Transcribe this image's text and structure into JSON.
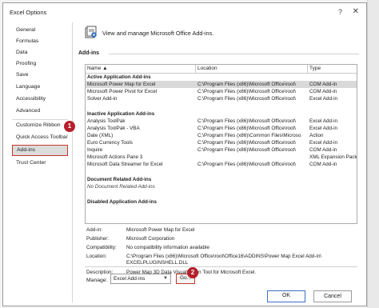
{
  "window": {
    "title": "Excel Options",
    "help_glyph": "?",
    "close_glyph": "✕"
  },
  "sidebar": {
    "items": [
      {
        "label": "General"
      },
      {
        "label": "Formulas"
      },
      {
        "label": "Data"
      },
      {
        "label": "Proofing"
      },
      {
        "label": "Save"
      },
      {
        "label": "Language"
      },
      {
        "label": "Accessibility"
      },
      {
        "label": "Advanced"
      },
      {
        "label": "Customize Ribbon"
      },
      {
        "label": "Quick Access Toolbar"
      },
      {
        "label": "Add-ins"
      },
      {
        "label": "Trust Center"
      }
    ],
    "active": "Add-ins"
  },
  "badges": {
    "step1": "1",
    "step2": "2"
  },
  "header": {
    "text": "View and manage Microsoft Office Add-ins."
  },
  "addins": {
    "section_title": "Add-ins",
    "columns": {
      "name": "Name ▲",
      "location": "Location",
      "type": "Type"
    },
    "rows": [
      {
        "name": "Active Application Add-ins",
        "location": "",
        "type": ""
      },
      {
        "name": "Microsoft Power Map for Excel",
        "location": "C:\\Program Files (x86)\\Microsoft Office\\root\\",
        "type": "COM Add-in"
      },
      {
        "name": "Microsoft Power Pivot for Excel",
        "location": "C:\\Program Files (x86)\\Microsoft Office\\root\\",
        "type": "COM Add-in"
      },
      {
        "name": "Solver Add-in",
        "location": "C:\\Program Files (x86)\\Microsoft Office\\root\\",
        "type": "Excel Add-in"
      },
      {
        "name": "",
        "location": "",
        "type": ""
      },
      {
        "name": "Inactive Application Add-ins",
        "location": "",
        "type": ""
      },
      {
        "name": "Analysis ToolPak",
        "location": "C:\\Program Files (x86)\\Microsoft Office\\root\\",
        "type": "Excel Add-in"
      },
      {
        "name": "Analysis ToolPak - VBA",
        "location": "C:\\Program Files (x86)\\Microsoft Office\\root\\",
        "type": "Excel Add-in"
      },
      {
        "name": "Date (XML)",
        "location": "C:\\Program Files (x86)\\Common Files\\Microso",
        "type": "Action"
      },
      {
        "name": "Euro Currency Tools",
        "location": "C:\\Program Files (x86)\\Microsoft Office\\root\\",
        "type": "Excel Add-in"
      },
      {
        "name": "Inquire",
        "location": "C:\\Program Files (x86)\\Microsoft Office\\root\\",
        "type": "COM Add-in"
      },
      {
        "name": "Microsoft Actions Pane 3",
        "location": "",
        "type": "XML Expansion Pack"
      },
      {
        "name": "Microsoft Data Streamer for Excel",
        "location": "C:\\Program Files (x86)\\Microsoft Office\\root\\",
        "type": "COM Add-in"
      },
      {
        "name": "",
        "location": "",
        "type": ""
      },
      {
        "name": "Document Related Add-ins",
        "location": "",
        "type": ""
      },
      {
        "name": "No Document Related Add-ins",
        "location": "",
        "type": ""
      },
      {
        "name": "",
        "location": "",
        "type": ""
      },
      {
        "name": "Disabled Application Add-ins",
        "location": "",
        "type": ""
      }
    ]
  },
  "details": {
    "addin_label": "Add-in:",
    "addin_value": "Microsoft Power Map for Excel",
    "publisher_label": "Publisher:",
    "publisher_value": "Microsoft Corporation",
    "compat_label": "Compatibility:",
    "compat_value": "No compatibility information available",
    "location_label": "Location:",
    "location_value_1": "C:\\Program Files (x86)\\Microsoft Office\\root\\Office16\\ADDINS\\Power Map Excel Add-in\\",
    "location_value_2": "EXCELPLUGINSHELL.DLL",
    "description_label": "Description:",
    "description_value": "Power Map 3D Data Visualization Tool for Microsoft Excel."
  },
  "manage": {
    "label": "Manage:",
    "selected": "Excel Add-ins",
    "go_label": "Go..."
  },
  "footer": {
    "ok_label": "OK",
    "cancel_label": "Cancel"
  },
  "colors": {
    "highlight": "#c0392b",
    "badge": "#b51f2b"
  }
}
